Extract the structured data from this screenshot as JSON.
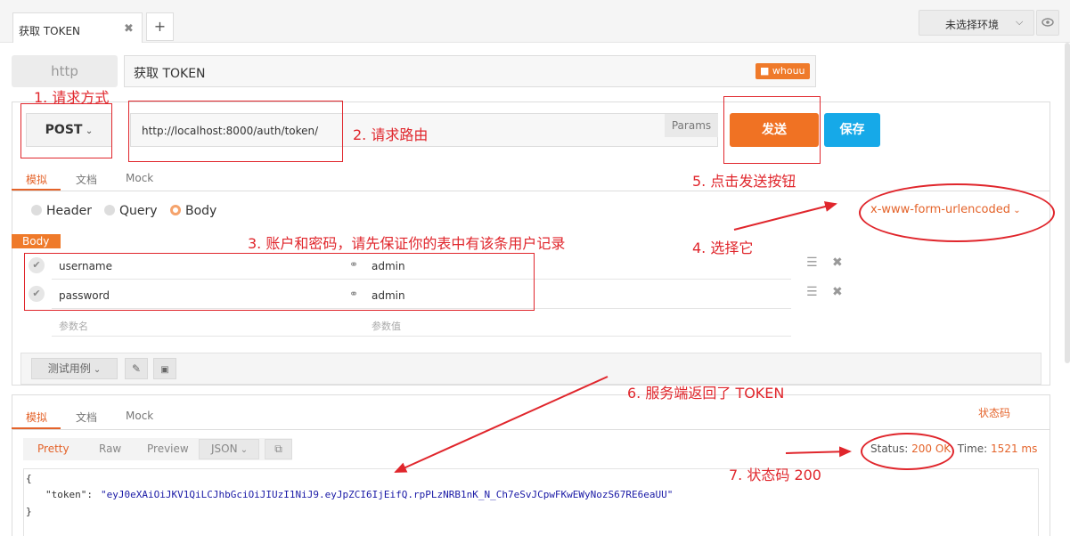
{
  "tabs": [
    {
      "label": "获取 TOKEN",
      "close": "✖"
    }
  ],
  "tab_add_label": "+",
  "environment": {
    "label": "未选择环境",
    "caret": "⌵"
  },
  "protocol_label": "http",
  "request_name": "获取 TOKEN",
  "user_badge": "whouu",
  "method": "POST",
  "url": "http://localhost:8000/auth/token/",
  "params_label": "Params",
  "send_label": "发送",
  "save_label": "保存",
  "request_tabs": [
    "模拟",
    "文档",
    "Mock"
  ],
  "param_types": [
    "Header",
    "Query",
    "Body"
  ],
  "selected_param_type": "Body",
  "encoding": "x-www-form-urlencoded",
  "body_label": "Body",
  "body_rows": [
    {
      "key": "username",
      "value": "admin"
    },
    {
      "key": "password",
      "value": "admin"
    }
  ],
  "placeholder_key": "参数名",
  "placeholder_value": "参数值",
  "test_case_label": "测试用例",
  "response_tabs": [
    "模拟",
    "文档",
    "Mock"
  ],
  "status_code_label": "状态码",
  "format_tabs": [
    "Pretty",
    "Raw",
    "Preview"
  ],
  "format_select": "JSON",
  "status": {
    "label": "Status:",
    "value": "200 OK",
    "time_label": "Time:",
    "time_value": "1521 ms"
  },
  "response_body": {
    "open": "{",
    "key": "\"token\":",
    "value": "\"eyJ0eXAiOiJKV1QiLCJhbGciOiJIUzI1NiJ9.eyJpZCI6IjEifQ.rpPLzNRB1nK_N_Ch7eSvJCpwFKwEWyNozS67RE6eaUU\"",
    "close": "}"
  },
  "annotations": [
    "1. 请求方式",
    "2. 请求路由",
    "3. 账户和密码，请先保证你的表中有该条用户记录",
    "4. 选择它",
    "5. 点击发送按钮",
    "6. 服务端返回了 TOKEN",
    "7. 状态码 200"
  ],
  "colors": {
    "accent": "#e4632a",
    "send": "#f07223",
    "save": "#16a9e8",
    "annotation": "#e0262c"
  }
}
